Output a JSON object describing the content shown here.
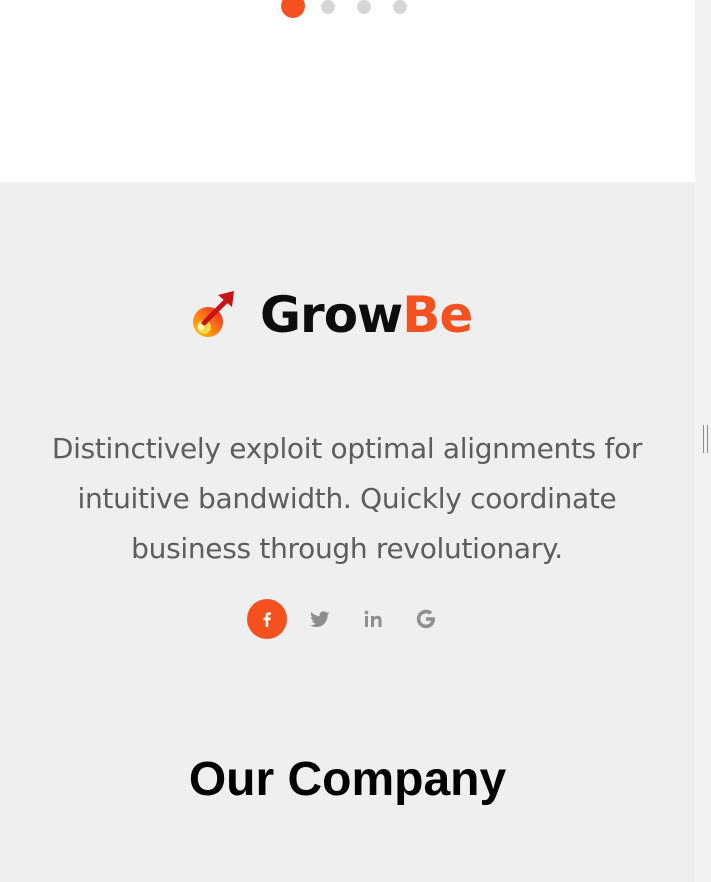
{
  "carousel": {
    "dots": [
      {
        "active": true
      },
      {
        "active": false
      },
      {
        "active": false
      },
      {
        "active": false
      }
    ]
  },
  "brand": {
    "name_part1": "Grow",
    "name_part2": "Be",
    "accent_color": "#f4511e",
    "logo_icon": "rocket-arrow-icon"
  },
  "footer": {
    "description": "Distinctively exploit optimal alignments for intuitive bandwidth. Quickly coordinate business through revolutionary.",
    "social": [
      {
        "name": "facebook",
        "icon": "facebook-icon",
        "active": true
      },
      {
        "name": "twitter",
        "icon": "twitter-icon",
        "active": false
      },
      {
        "name": "linkedin",
        "icon": "linkedin-icon",
        "active": false
      },
      {
        "name": "google",
        "icon": "google-icon",
        "active": false
      }
    ],
    "section_title": "Our Company"
  }
}
